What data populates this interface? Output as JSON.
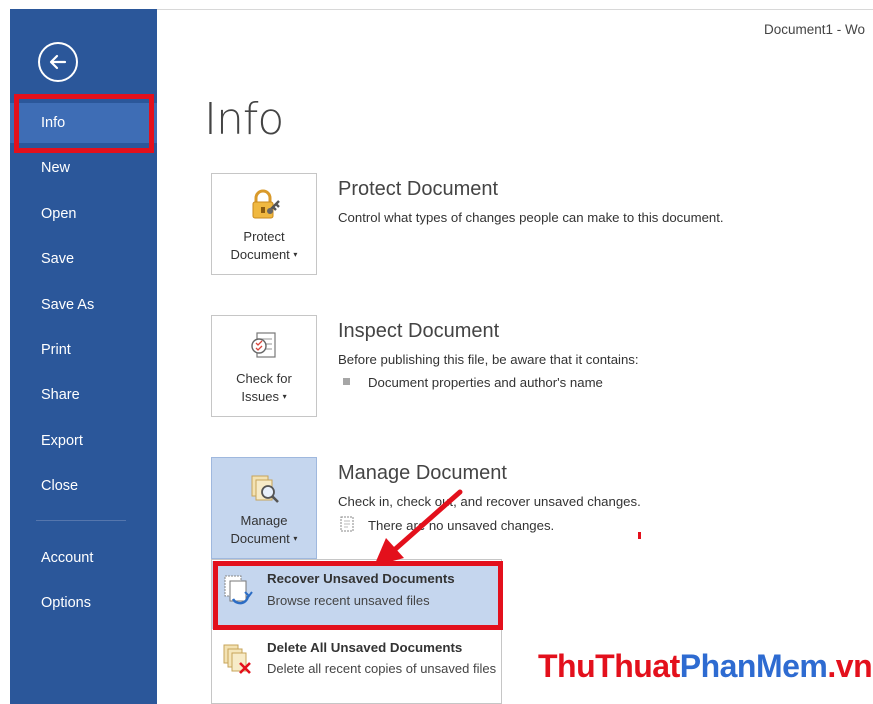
{
  "window": {
    "title": "Document1 - Wo"
  },
  "sidebar": {
    "back_icon": "back-arrow-icon",
    "items": [
      {
        "label": "Info",
        "active": true
      },
      {
        "label": "New"
      },
      {
        "label": "Open"
      },
      {
        "label": "Save"
      },
      {
        "label": "Save As"
      },
      {
        "label": "Print"
      },
      {
        "label": "Share"
      },
      {
        "label": "Export"
      },
      {
        "label": "Close"
      },
      {
        "label": "Account"
      },
      {
        "label": "Options"
      }
    ],
    "color": "#2b579a"
  },
  "main": {
    "title": "Info",
    "sections": {
      "protect": {
        "tile_line1": "Protect",
        "tile_line2": "Document",
        "title": "Protect Document",
        "desc": "Control what types of changes people can make to this document.",
        "icon": "lock-key-icon"
      },
      "inspect": {
        "tile_line1": "Check for",
        "tile_line2": "Issues",
        "title": "Inspect Document",
        "desc": "Before publishing this file, be aware that it contains:",
        "bullet": "Document properties and author's name",
        "icon": "checklist-icon"
      },
      "manage": {
        "tile_line1": "Manage",
        "tile_line2": "Document",
        "title": "Manage Document",
        "desc": "Check in, check out, and recover unsaved changes.",
        "status": "There are no unsaved changes.",
        "icon": "document-search-icon"
      }
    }
  },
  "dropdown": {
    "items": [
      {
        "title": "Recover Unsaved Documents",
        "desc": "Browse recent unsaved files",
        "icon": "recover-document-icon"
      },
      {
        "title": "Delete All Unsaved Documents",
        "desc": "Delete all recent copies of unsaved files",
        "icon": "delete-documents-icon"
      }
    ]
  },
  "watermark": {
    "part1": "ThuThuat",
    "part2": "PhanMem",
    "part3": ".vn"
  },
  "colors": {
    "highlight": "#e3101c",
    "accent": "#2b579a",
    "selected": "#c5d6ee"
  }
}
